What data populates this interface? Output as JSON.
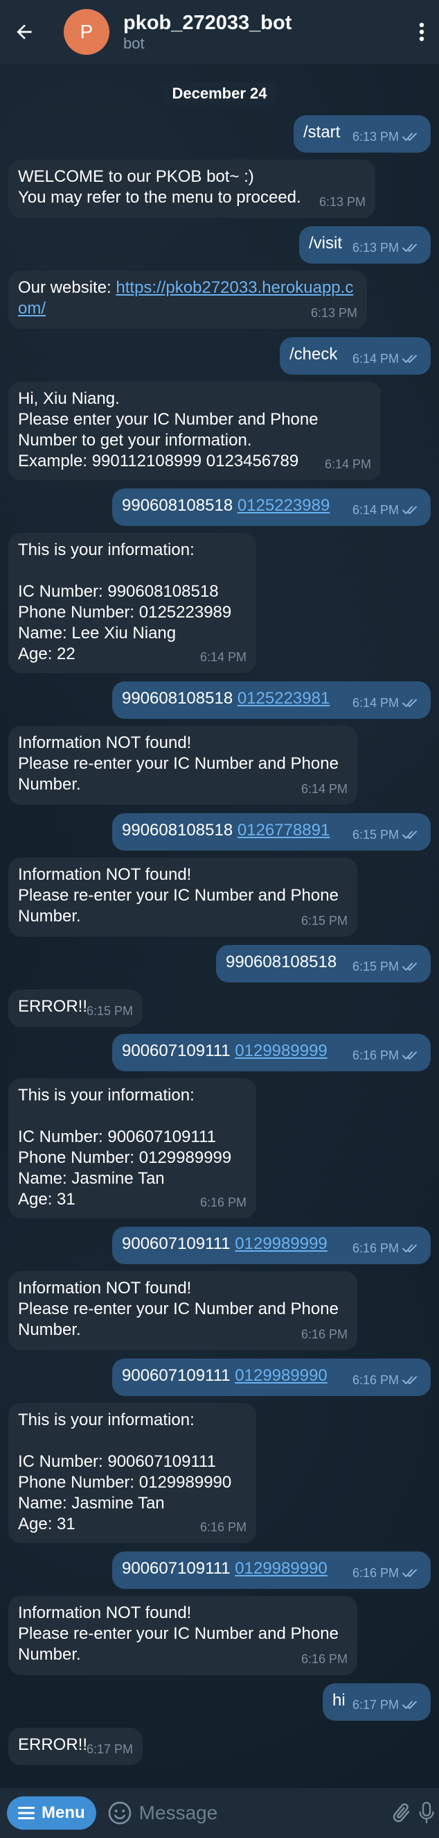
{
  "header": {
    "avatar_letter": "P",
    "title": "pkob_272033_bot",
    "subtitle": "bot"
  },
  "chat": {
    "date": "December 24",
    "messages": [
      {
        "dir": "out",
        "text": "/start",
        "time": "6:13 PM"
      },
      {
        "dir": "in",
        "text": "WELCOME to our PKOB bot~ :)\nYou may refer to the menu to proceed.",
        "time": "6:13 PM"
      },
      {
        "dir": "out",
        "text": "/visit",
        "time": "6:13 PM"
      },
      {
        "dir": "in",
        "prefix": "Our website: ",
        "link": "https://pkob272033.herokuapp.com/",
        "time": "6:13 PM"
      },
      {
        "dir": "out",
        "text": "/check",
        "time": "6:14 PM"
      },
      {
        "dir": "in",
        "text": "Hi, Xiu Niang.\nPlease enter your IC Number and Phone Number to get your information.\nExample: 990112108999 0123456789",
        "time": "6:14 PM"
      },
      {
        "dir": "out",
        "ic": "990608108518",
        "phone": "0125223989",
        "time": "6:14 PM"
      },
      {
        "dir": "in",
        "text": "This is your information:\n\nIC Number: 990608108518\nPhone Number: 0125223989\nName: Lee Xiu Niang\nAge: 22",
        "time": "6:14 PM"
      },
      {
        "dir": "out",
        "ic": "990608108518",
        "phone": "0125223981",
        "time": "6:14 PM"
      },
      {
        "dir": "in",
        "text": "Information NOT found!\nPlease re-enter your IC Number and Phone Number.",
        "time": "6:14 PM"
      },
      {
        "dir": "out",
        "ic": "990608108518",
        "phone": "0126778891",
        "time": "6:15 PM"
      },
      {
        "dir": "in",
        "text": "Information NOT found!\nPlease re-enter your IC Number and Phone Number.",
        "time": "6:15 PM"
      },
      {
        "dir": "out",
        "text": "990608108518",
        "time": "6:15 PM"
      },
      {
        "dir": "in",
        "text": "ERROR!!",
        "time": "6:15 PM"
      },
      {
        "dir": "out",
        "ic": "900607109111",
        "phone": "0129989999",
        "time": "6:16 PM"
      },
      {
        "dir": "in",
        "text": "This is your information:\n\nIC Number: 900607109111\nPhone Number: 0129989999\nName: Jasmine Tan\nAge: 31",
        "time": "6:16 PM"
      },
      {
        "dir": "out",
        "ic": "900607109111",
        "phone": "0129989999",
        "time": "6:16 PM"
      },
      {
        "dir": "in",
        "text": "Information NOT found!\nPlease re-enter your IC Number and Phone Number.",
        "time": "6:16 PM"
      },
      {
        "dir": "out",
        "ic": "900607109111",
        "phone": "0129989990",
        "time": "6:16 PM"
      },
      {
        "dir": "in",
        "text": "This is your information:\n\nIC Number: 900607109111\nPhone Number: 0129989990\nName: Jasmine Tan\nAge: 31",
        "time": "6:16 PM"
      },
      {
        "dir": "out",
        "ic": "900607109111",
        "phone": "0129989990",
        "time": "6:16 PM"
      },
      {
        "dir": "in",
        "text": "Information NOT found!\nPlease re-enter your IC Number and Phone Number.",
        "time": "6:16 PM"
      },
      {
        "dir": "out",
        "text": "hi",
        "time": "6:17 PM"
      },
      {
        "dir": "in",
        "text": "ERROR!!",
        "time": "6:17 PM"
      }
    ]
  },
  "bottom": {
    "menu_label": "Menu",
    "input_placeholder": "Message"
  },
  "colors": {
    "header_bg": "#1e2c3a",
    "incoming_bubble": "#222e3a",
    "outgoing_bubble": "#2b5278",
    "link": "#6ab2f2",
    "menu_button": "#3e8fd6",
    "avatar": "#e37c52"
  },
  "icons": [
    "back-arrow-icon",
    "more-vertical-icon",
    "double-check-icon",
    "menu-lines-icon",
    "emoji-icon",
    "attach-icon",
    "mic-icon"
  ]
}
